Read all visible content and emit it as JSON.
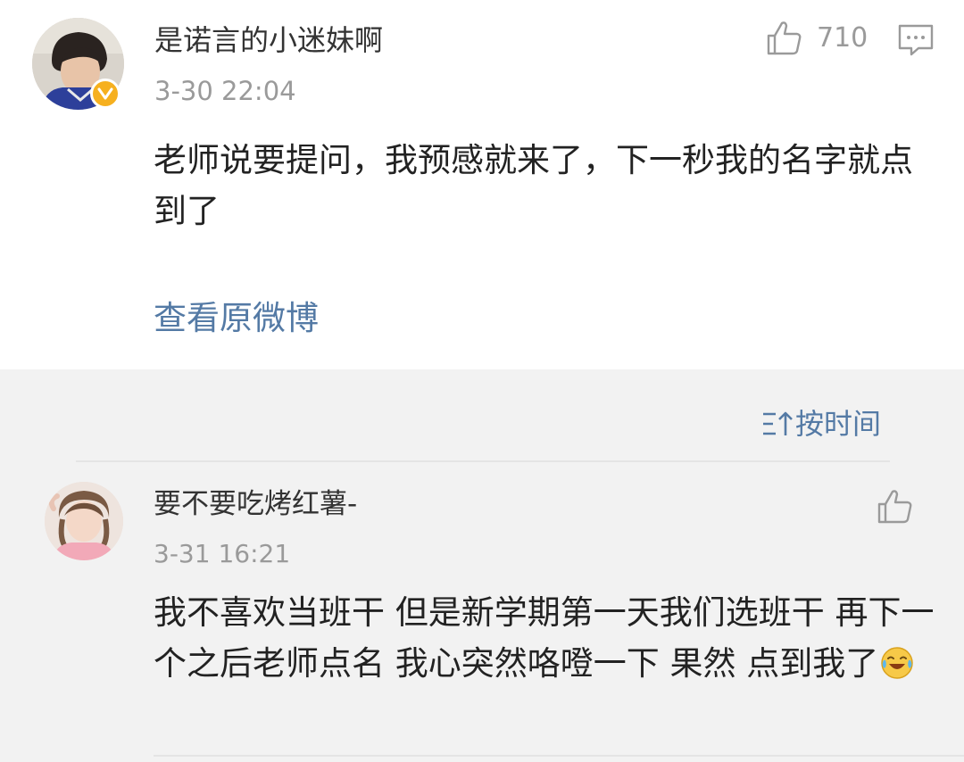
{
  "main_comment": {
    "username": "是诺言的小迷妹啊",
    "timestamp": "3-30 22:04",
    "like_count": "710",
    "text": "老师说要提问，我预感就来了，下一秒我的名字就点到了",
    "view_original_label": "查看原微博",
    "verified_badge_color": "#f6b01f"
  },
  "sort": {
    "label": "按时间"
  },
  "reply": {
    "username": "要不要吃烤红薯-",
    "timestamp": "3-31 16:21",
    "text": "我不喜欢当班干 但是新学期第一天我们选班干 再下一个之后老师点名 我心突然咯噔一下 果然 点到我了",
    "emoji": "crying-laughing-emoji"
  },
  "colors": {
    "link": "#547aa5",
    "secondary_text": "#9a9a9a",
    "primary_text": "#222222",
    "background": "#f2f2f2"
  }
}
